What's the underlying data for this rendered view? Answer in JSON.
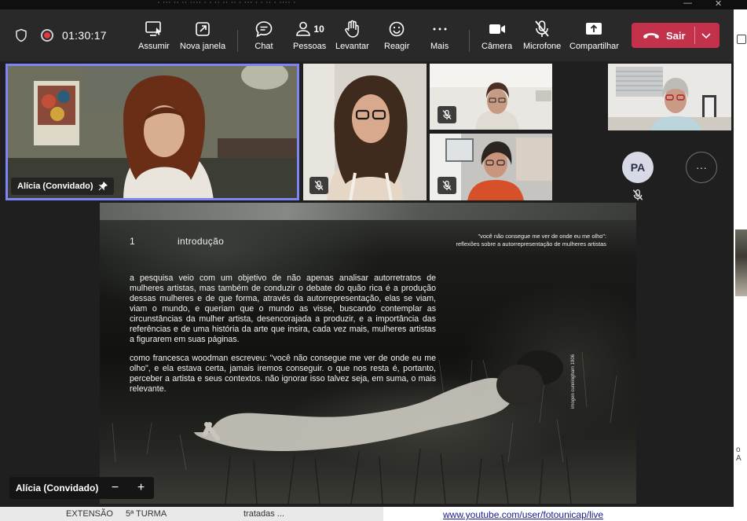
{
  "window": {
    "title": "· ··· ·· ·· ···· · · ·· ·· ·· · ··· · · ·· · ···· ·",
    "controls": [
      "—",
      "✕"
    ]
  },
  "toolbar": {
    "timer": "01:30:17",
    "buttons": [
      {
        "label": "Assumir",
        "icon": "take-control-icon"
      },
      {
        "label": "Nova janela",
        "icon": "pop-out-icon"
      },
      {
        "label": "Chat",
        "icon": "chat-icon"
      },
      {
        "label": "Pessoas",
        "icon": "people-icon",
        "count": "10"
      },
      {
        "label": "Levantar",
        "icon": "raise-hand-icon"
      },
      {
        "label": "Reagir",
        "icon": "react-icon"
      },
      {
        "label": "Mais",
        "icon": "more-icon"
      },
      {
        "label": "Câmera",
        "icon": "camera-icon"
      },
      {
        "label": "Microfone",
        "icon": "mic-off-icon"
      },
      {
        "label": "Compartilhar",
        "icon": "share-icon"
      }
    ],
    "leave_label": "Sair"
  },
  "participants": {
    "active_speaker": "Alícia (Convidado)",
    "avatar_initials": "PA",
    "more_label": "···"
  },
  "slide": {
    "number": "1",
    "title": "introdução",
    "quote_line1": "\"você não consegue  me ver de onde eu me olho\":",
    "quote_line2": "reflexões sobre a autorrepresentação  de mulheres artistas",
    "paragraph1": "a pesquisa veio com um objetivo de não apenas analisar autorretratos de mulheres artistas, mas também de conduzir o debate do quão rica é a produção dessas mulheres e de que forma, através da autorrepresentação, elas se viam, viam o mundo, e queriam que o mundo as visse, buscando contemplar as circunstâncias da mulher artista, desencorajada a produzir, e a importância das referências e de uma história da arte que insira, cada vez mais, mulheres artistas a figurarem em suas páginas.",
    "paragraph2": "como francesca woodman escreveu: \"você não consegue me ver de onde eu me olho\", e ela estava certa, jamais iremos conseguir. o que nos resta é, portanto, perceber a artista e seus contextos. não ignorar isso talvez seja, em suma, o mais relevante.",
    "credit": "imogen cunningham  1906"
  },
  "share_controls": {
    "presenter": "Alícia (Convidado)",
    "zoom_out": "−",
    "zoom_in": "+"
  },
  "background": {
    "row_texts": [
      "EXTENSÃO",
      "5ª TURMA",
      "tratadas ..."
    ],
    "link": "www.youtube.com/user/fotounicap/live",
    "side_text": "o A"
  },
  "colors": {
    "accent": "#7f85f5",
    "leave": "#c4314b",
    "toolbar": "#292929",
    "stage": "#1f1f1f",
    "recording": "#e0393e"
  }
}
